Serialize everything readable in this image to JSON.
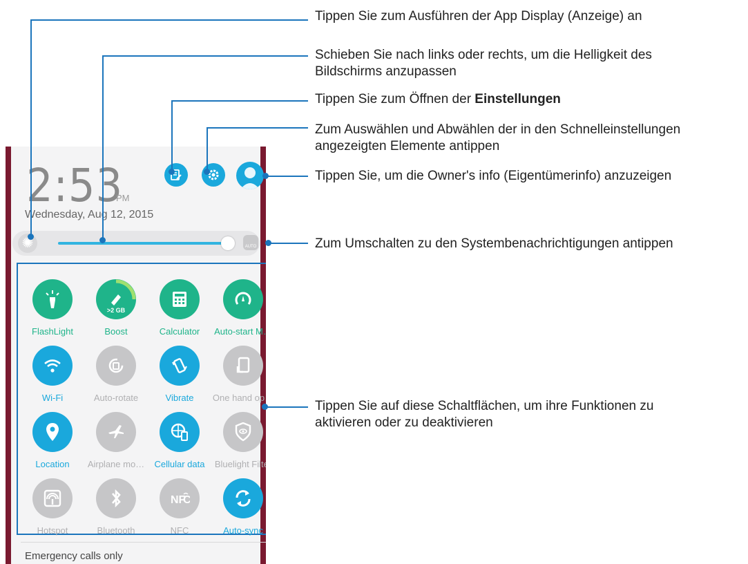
{
  "status": {
    "time": "2:53",
    "ampm": "PM",
    "date": "Wednesday, Aug 12, 2015",
    "emergency": "Emergency calls only"
  },
  "top_icons": [
    "display-app-icon",
    "settings-gear-icon",
    "owner-avatar-icon"
  ],
  "brightness": {
    "level_percent": 100,
    "auto_label": "AUTO"
  },
  "tiles": [
    {
      "label": "FlashLight",
      "state": "on",
      "color": "#1fb48a",
      "icon": "flashlight-icon"
    },
    {
      "label": "Boost",
      "state": "on",
      "color": "#1fb48a",
      "icon": "boost-icon",
      "badge": ">2 GB"
    },
    {
      "label": "Calculator",
      "state": "on",
      "color": "#1fb48a",
      "icon": "calculator-icon"
    },
    {
      "label": "Auto-start M…",
      "state": "on",
      "color": "#1fb48a",
      "icon": "autostart-icon"
    },
    {
      "label": "Wi-Fi",
      "state": "on",
      "color": "#1aa8dc",
      "icon": "wifi-icon"
    },
    {
      "label": "Auto-rotate",
      "state": "off",
      "color": "#c6c6c8",
      "icon": "rotate-icon"
    },
    {
      "label": "Vibrate",
      "state": "on",
      "color": "#1aa8dc",
      "icon": "vibrate-icon"
    },
    {
      "label": "One hand op…",
      "state": "off",
      "color": "#c6c6c8",
      "icon": "one-hand-icon"
    },
    {
      "label": "Location",
      "state": "on",
      "color": "#1aa8dc",
      "icon": "location-pin-icon"
    },
    {
      "label": "Airplane mo…",
      "state": "off",
      "color": "#c6c6c8",
      "icon": "airplane-icon"
    },
    {
      "label": "Cellular data",
      "state": "on",
      "color": "#1aa8dc",
      "icon": "cellular-data-icon"
    },
    {
      "label": "Bluelight Filter",
      "state": "off",
      "color": "#c6c6c8",
      "icon": "bluelight-filter-icon"
    },
    {
      "label": "Hotspot",
      "state": "off",
      "color": "#c6c6c8",
      "icon": "hotspot-icon"
    },
    {
      "label": "Bluetooth",
      "state": "off",
      "color": "#c6c6c8",
      "icon": "bluetooth-icon"
    },
    {
      "label": "NFC",
      "state": "off",
      "color": "#c6c6c8",
      "icon": "nfc-icon"
    },
    {
      "label": "Auto-sync",
      "state": "on",
      "color": "#1aa8dc",
      "icon": "sync-icon"
    }
  ],
  "notes": {
    "n1": "Tippen Sie zum Ausführen der App Display (Anzeige) an",
    "n2a": "Schieben Sie nach links oder rechts, um die Helligkeit des",
    "n2b": "Bildschirms anzupassen",
    "n3a": "Tippen Sie zum Öffnen der ",
    "n3b": "Einstellungen",
    "n4a": "Zum Auswählen und Abwählen der in den Schnelleinstellungen",
    "n4b": "angezeigten Elemente antippen",
    "n5": "Tippen Sie, um die Owner's info (Eigentümerinfo) anzuzeigen",
    "n6": "Zum Umschalten zu den Systembenachrichtigungen antippen",
    "n7a": "Tippen Sie auf diese Schaltflächen, um ihre Funktionen zu",
    "n7b": "aktivieren oder zu deaktivieren"
  },
  "accent_color": "#1b75bc"
}
